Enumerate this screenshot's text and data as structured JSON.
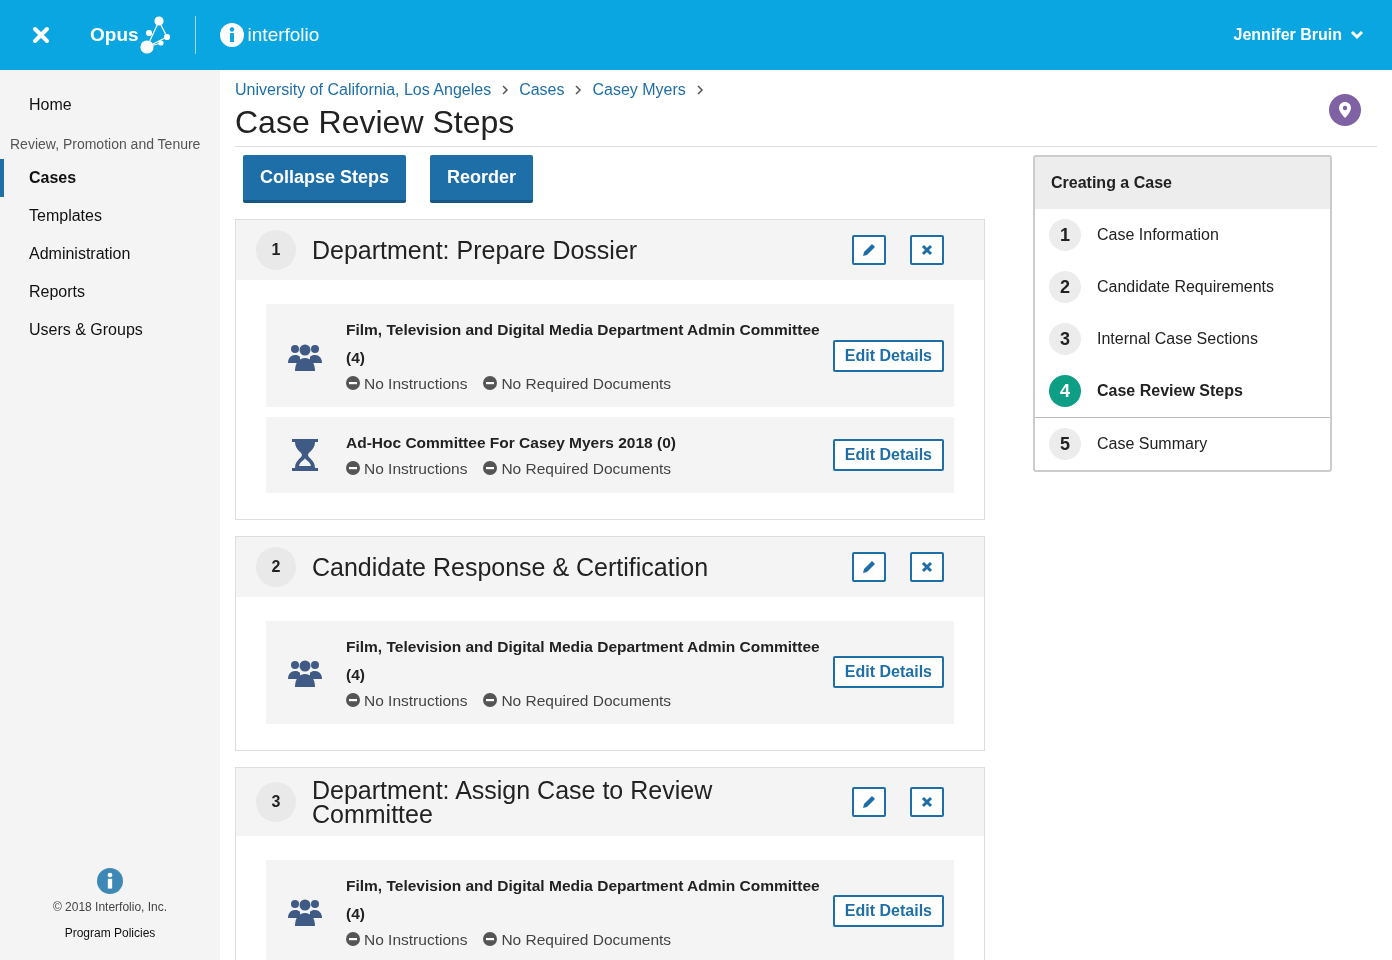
{
  "header": {
    "app_name": "Opus",
    "brand": "interfolio",
    "user": "Jennifer Bruin"
  },
  "sidebar": {
    "items": [
      {
        "kind": "link",
        "label": "Home",
        "selected": false
      },
      {
        "kind": "heading",
        "label": "Review, Promotion and Tenure"
      },
      {
        "kind": "link",
        "label": "Cases",
        "selected": true
      },
      {
        "kind": "link",
        "label": "Templates",
        "selected": false
      },
      {
        "kind": "link",
        "label": "Administration",
        "selected": false
      },
      {
        "kind": "link",
        "label": "Reports",
        "selected": false
      },
      {
        "kind": "link",
        "label": "Users & Groups",
        "selected": false
      }
    ],
    "copyright": "© 2018 Interfolio, Inc.",
    "policies": "Program Policies"
  },
  "breadcrumb": [
    "University of California, Los Angeles",
    "Cases",
    "Casey Myers"
  ],
  "title": "Case Review Steps",
  "buttons": [
    "Collapse Steps",
    "Reorder"
  ],
  "steps": [
    {
      "number": "1",
      "title": "Department: Prepare Dossier",
      "entries": [
        {
          "kind": "committee",
          "name": "Film, Television and Digital Media Department Admin Committee (4)",
          "instructions": "No Instructions",
          "documents": "No Required Documents",
          "button": "Edit Details"
        },
        {
          "kind": "adhoc",
          "name": "Ad-Hoc Committee For Casey Myers 2018 (0)",
          "instructions": "No Instructions",
          "documents": "No Required Documents",
          "button": "Edit Details"
        }
      ]
    },
    {
      "number": "2",
      "title": "Candidate Response & Certification",
      "entries": [
        {
          "kind": "committee",
          "name": "Film, Television and Digital Media Department Admin Committee (4)",
          "instructions": "No Instructions",
          "documents": "No Required Documents",
          "button": "Edit Details"
        }
      ]
    },
    {
      "number": "3",
      "title": "Department: Assign Case to Review Committee",
      "entries": [
        {
          "kind": "committee",
          "name": "Film, Television and Digital Media Department Admin Committee (4)",
          "instructions": "No Instructions",
          "documents": "No Required Documents",
          "button": "Edit Details"
        }
      ]
    }
  ],
  "wizard": {
    "title": "Creating a Case",
    "steps": [
      {
        "number": "1",
        "label": "Case Information",
        "selected": false
      },
      {
        "number": "2",
        "label": "Candidate Requirements",
        "selected": false
      },
      {
        "number": "3",
        "label": "Internal Case Sections",
        "selected": false
      },
      {
        "number": "4",
        "label": "Case Review Steps",
        "selected": true
      },
      {
        "number": "5",
        "label": "Case Summary",
        "selected": false
      }
    ]
  }
}
